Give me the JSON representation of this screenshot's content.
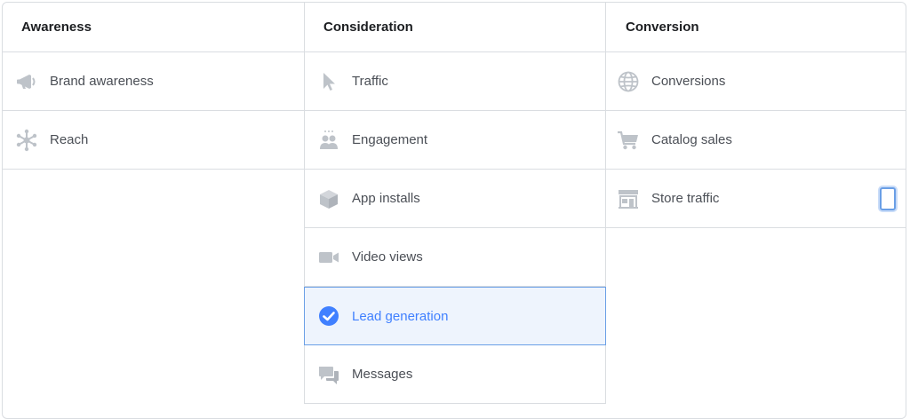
{
  "columns": [
    {
      "header": "Awareness",
      "items": [
        {
          "label": "Brand awareness",
          "icon": "megaphone-icon"
        },
        {
          "label": "Reach",
          "icon": "reach-icon"
        }
      ]
    },
    {
      "header": "Consideration",
      "items": [
        {
          "label": "Traffic",
          "icon": "cursor-icon"
        },
        {
          "label": "Engagement",
          "icon": "people-icon"
        },
        {
          "label": "App installs",
          "icon": "box-icon"
        },
        {
          "label": "Video views",
          "icon": "video-camera-icon"
        },
        {
          "label": "Lead generation",
          "icon": "check-circle-icon",
          "selected": true
        },
        {
          "label": "Messages",
          "icon": "chat-bubbles-icon"
        }
      ]
    },
    {
      "header": "Conversion",
      "items": [
        {
          "label": "Conversions",
          "icon": "globe-icon"
        },
        {
          "label": "Catalog sales",
          "icon": "shopping-cart-icon"
        },
        {
          "label": "Store traffic",
          "icon": "store-icon"
        }
      ]
    }
  ],
  "colors": {
    "icon_gray": "#bec3c9",
    "selected_blue": "#4080ff",
    "selected_bg": "#eef4fd",
    "border": "#dadde1",
    "text": "#4b4f56",
    "header_text": "#1c1e21"
  }
}
